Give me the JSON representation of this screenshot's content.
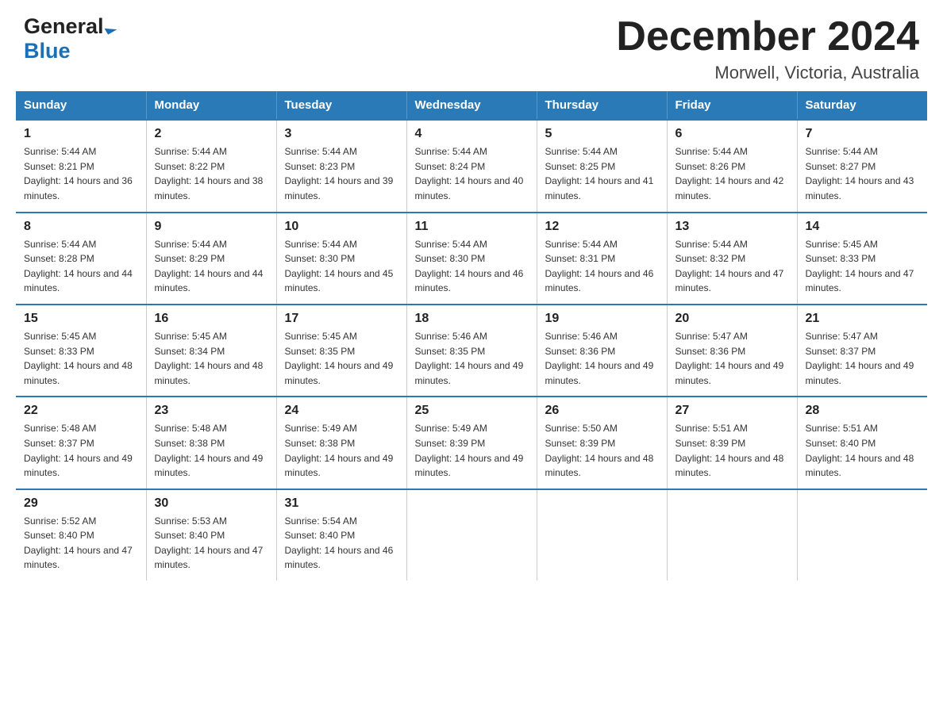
{
  "header": {
    "logo_general": "General",
    "logo_blue": "Blue",
    "month_title": "December 2024",
    "location": "Morwell, Victoria, Australia"
  },
  "days_of_week": [
    "Sunday",
    "Monday",
    "Tuesday",
    "Wednesday",
    "Thursday",
    "Friday",
    "Saturday"
  ],
  "weeks": [
    [
      {
        "day": "1",
        "sunrise": "Sunrise: 5:44 AM",
        "sunset": "Sunset: 8:21 PM",
        "daylight": "Daylight: 14 hours and 36 minutes."
      },
      {
        "day": "2",
        "sunrise": "Sunrise: 5:44 AM",
        "sunset": "Sunset: 8:22 PM",
        "daylight": "Daylight: 14 hours and 38 minutes."
      },
      {
        "day": "3",
        "sunrise": "Sunrise: 5:44 AM",
        "sunset": "Sunset: 8:23 PM",
        "daylight": "Daylight: 14 hours and 39 minutes."
      },
      {
        "day": "4",
        "sunrise": "Sunrise: 5:44 AM",
        "sunset": "Sunset: 8:24 PM",
        "daylight": "Daylight: 14 hours and 40 minutes."
      },
      {
        "day": "5",
        "sunrise": "Sunrise: 5:44 AM",
        "sunset": "Sunset: 8:25 PM",
        "daylight": "Daylight: 14 hours and 41 minutes."
      },
      {
        "day": "6",
        "sunrise": "Sunrise: 5:44 AM",
        "sunset": "Sunset: 8:26 PM",
        "daylight": "Daylight: 14 hours and 42 minutes."
      },
      {
        "day": "7",
        "sunrise": "Sunrise: 5:44 AM",
        "sunset": "Sunset: 8:27 PM",
        "daylight": "Daylight: 14 hours and 43 minutes."
      }
    ],
    [
      {
        "day": "8",
        "sunrise": "Sunrise: 5:44 AM",
        "sunset": "Sunset: 8:28 PM",
        "daylight": "Daylight: 14 hours and 44 minutes."
      },
      {
        "day": "9",
        "sunrise": "Sunrise: 5:44 AM",
        "sunset": "Sunset: 8:29 PM",
        "daylight": "Daylight: 14 hours and 44 minutes."
      },
      {
        "day": "10",
        "sunrise": "Sunrise: 5:44 AM",
        "sunset": "Sunset: 8:30 PM",
        "daylight": "Daylight: 14 hours and 45 minutes."
      },
      {
        "day": "11",
        "sunrise": "Sunrise: 5:44 AM",
        "sunset": "Sunset: 8:30 PM",
        "daylight": "Daylight: 14 hours and 46 minutes."
      },
      {
        "day": "12",
        "sunrise": "Sunrise: 5:44 AM",
        "sunset": "Sunset: 8:31 PM",
        "daylight": "Daylight: 14 hours and 46 minutes."
      },
      {
        "day": "13",
        "sunrise": "Sunrise: 5:44 AM",
        "sunset": "Sunset: 8:32 PM",
        "daylight": "Daylight: 14 hours and 47 minutes."
      },
      {
        "day": "14",
        "sunrise": "Sunrise: 5:45 AM",
        "sunset": "Sunset: 8:33 PM",
        "daylight": "Daylight: 14 hours and 47 minutes."
      }
    ],
    [
      {
        "day": "15",
        "sunrise": "Sunrise: 5:45 AM",
        "sunset": "Sunset: 8:33 PM",
        "daylight": "Daylight: 14 hours and 48 minutes."
      },
      {
        "day": "16",
        "sunrise": "Sunrise: 5:45 AM",
        "sunset": "Sunset: 8:34 PM",
        "daylight": "Daylight: 14 hours and 48 minutes."
      },
      {
        "day": "17",
        "sunrise": "Sunrise: 5:45 AM",
        "sunset": "Sunset: 8:35 PM",
        "daylight": "Daylight: 14 hours and 49 minutes."
      },
      {
        "day": "18",
        "sunrise": "Sunrise: 5:46 AM",
        "sunset": "Sunset: 8:35 PM",
        "daylight": "Daylight: 14 hours and 49 minutes."
      },
      {
        "day": "19",
        "sunrise": "Sunrise: 5:46 AM",
        "sunset": "Sunset: 8:36 PM",
        "daylight": "Daylight: 14 hours and 49 minutes."
      },
      {
        "day": "20",
        "sunrise": "Sunrise: 5:47 AM",
        "sunset": "Sunset: 8:36 PM",
        "daylight": "Daylight: 14 hours and 49 minutes."
      },
      {
        "day": "21",
        "sunrise": "Sunrise: 5:47 AM",
        "sunset": "Sunset: 8:37 PM",
        "daylight": "Daylight: 14 hours and 49 minutes."
      }
    ],
    [
      {
        "day": "22",
        "sunrise": "Sunrise: 5:48 AM",
        "sunset": "Sunset: 8:37 PM",
        "daylight": "Daylight: 14 hours and 49 minutes."
      },
      {
        "day": "23",
        "sunrise": "Sunrise: 5:48 AM",
        "sunset": "Sunset: 8:38 PM",
        "daylight": "Daylight: 14 hours and 49 minutes."
      },
      {
        "day": "24",
        "sunrise": "Sunrise: 5:49 AM",
        "sunset": "Sunset: 8:38 PM",
        "daylight": "Daylight: 14 hours and 49 minutes."
      },
      {
        "day": "25",
        "sunrise": "Sunrise: 5:49 AM",
        "sunset": "Sunset: 8:39 PM",
        "daylight": "Daylight: 14 hours and 49 minutes."
      },
      {
        "day": "26",
        "sunrise": "Sunrise: 5:50 AM",
        "sunset": "Sunset: 8:39 PM",
        "daylight": "Daylight: 14 hours and 48 minutes."
      },
      {
        "day": "27",
        "sunrise": "Sunrise: 5:51 AM",
        "sunset": "Sunset: 8:39 PM",
        "daylight": "Daylight: 14 hours and 48 minutes."
      },
      {
        "day": "28",
        "sunrise": "Sunrise: 5:51 AM",
        "sunset": "Sunset: 8:40 PM",
        "daylight": "Daylight: 14 hours and 48 minutes."
      }
    ],
    [
      {
        "day": "29",
        "sunrise": "Sunrise: 5:52 AM",
        "sunset": "Sunset: 8:40 PM",
        "daylight": "Daylight: 14 hours and 47 minutes."
      },
      {
        "day": "30",
        "sunrise": "Sunrise: 5:53 AM",
        "sunset": "Sunset: 8:40 PM",
        "daylight": "Daylight: 14 hours and 47 minutes."
      },
      {
        "day": "31",
        "sunrise": "Sunrise: 5:54 AM",
        "sunset": "Sunset: 8:40 PM",
        "daylight": "Daylight: 14 hours and 46 minutes."
      },
      null,
      null,
      null,
      null
    ]
  ]
}
